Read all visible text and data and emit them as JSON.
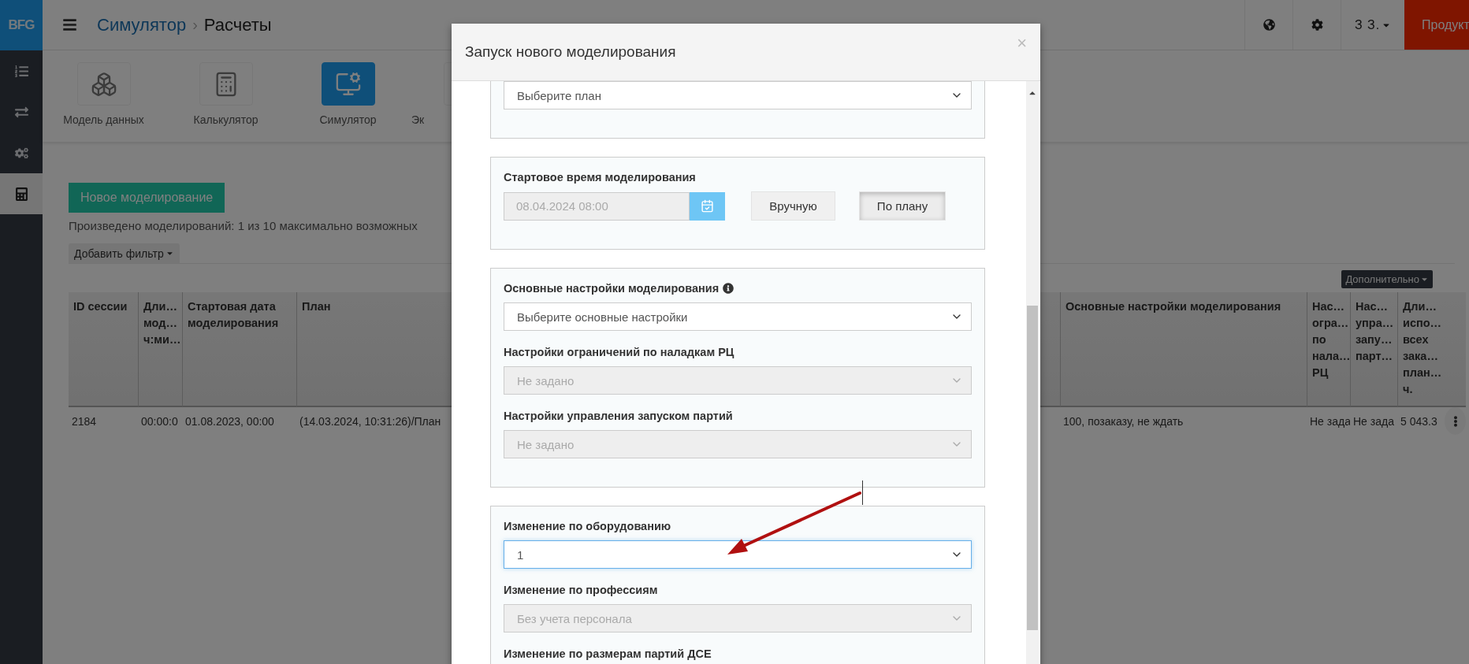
{
  "sidebar": {
    "logo": "BFG",
    "items": [
      {
        "kind": "list",
        "selected": false
      },
      {
        "kind": "transfer",
        "selected": false
      },
      {
        "kind": "settings",
        "selected": false
      },
      {
        "kind": "calculator",
        "selected": true
      }
    ]
  },
  "header": {
    "breadcrumb": [
      {
        "label": "Симулятор",
        "kind": "link"
      },
      {
        "label": "Расчеты",
        "kind": "current"
      }
    ],
    "separator": "›",
    "tools": [
      {
        "kind": "globe"
      },
      {
        "kind": "settings"
      }
    ],
    "user": "З З.",
    "product_button": "Продукт"
  },
  "modules": [
    {
      "label": "Модель данных",
      "kind": "cubes",
      "selected": false
    },
    {
      "label": "Калькулятор",
      "kind": "calculator",
      "selected": false
    },
    {
      "label": "Симулятор",
      "kind": "monitor",
      "selected": true
    },
    {
      "label": "Эк",
      "kind": "blank",
      "selected": false
    }
  ],
  "toolbar": {
    "new_button": "Новое моделирование",
    "info": "Произведено моделирований: 1 из 10 максимально возможных",
    "filter_button": "Добавить фильтр",
    "more_button": "Дополнительно"
  },
  "table": {
    "columns": [
      {
        "lines": [
          "ID сессии"
        ]
      },
      {
        "lines": [
          "Дли…",
          "мод…",
          "ч:ми…"
        ]
      },
      {
        "lines": [
          "Стартовая дата",
          "моделирования"
        ]
      },
      {
        "lines": [
          "План"
        ]
      },
      {
        "lines": [
          "Основные настройки моделирования"
        ]
      },
      {
        "lines": [
          "Нас…",
          "огра…",
          "по",
          "нала…",
          "РЦ"
        ]
      },
      {
        "lines": [
          "Нас…",
          "упра…",
          "запу…",
          "парт…"
        ]
      },
      {
        "lines": [
          "Дли…",
          "испо…",
          "всех",
          "зака…",
          "план…",
          "ч."
        ]
      }
    ],
    "rows": [
      {
        "cells": [
          "2184",
          "00:00:0",
          "01.08.2023, 00:00",
          "(14.03.2024, 10:31:26)/План",
          "100, позаказу, не ждать",
          "Не зада",
          "Не зада",
          "5 043.3"
        ]
      }
    ]
  },
  "modal": {
    "title": "Запуск нового моделирования",
    "close": "×",
    "panels": [
      {
        "fields": [
          {
            "kind": "select",
            "value": "Выберите план",
            "disabled": false,
            "focused": false
          }
        ]
      },
      {
        "fields": [
          {
            "kind": "datetime",
            "label": "Стартовое время моделирования",
            "value": "08.04.2024 08:00",
            "disabled": true,
            "modes": [
              {
                "label": "Вручную",
                "selected": false
              },
              {
                "label": "По плану",
                "selected": true
              }
            ]
          }
        ]
      },
      {
        "fields": [
          {
            "kind": "select",
            "label": "Основные настройки моделирования",
            "info": true,
            "value": "Выберите основные настройки",
            "disabled": false,
            "focused": false
          },
          {
            "kind": "select",
            "label": "Настройки ограничений по наладкам РЦ",
            "value": "Не задано",
            "disabled": true,
            "focused": false
          },
          {
            "kind": "select",
            "label": "Настройки управления запуском партий",
            "value": "Не задано",
            "disabled": true,
            "focused": false
          }
        ]
      },
      {
        "fields": [
          {
            "kind": "select",
            "label": "Изменение по оборудованию",
            "value": "1",
            "disabled": false,
            "focused": true
          },
          {
            "kind": "select",
            "label": "Изменение по профессиям",
            "value": "Без учета персонала",
            "disabled": true,
            "focused": false
          },
          {
            "kind": "label",
            "label": "Изменение по размерам партий ДСЕ"
          }
        ]
      }
    ]
  }
}
